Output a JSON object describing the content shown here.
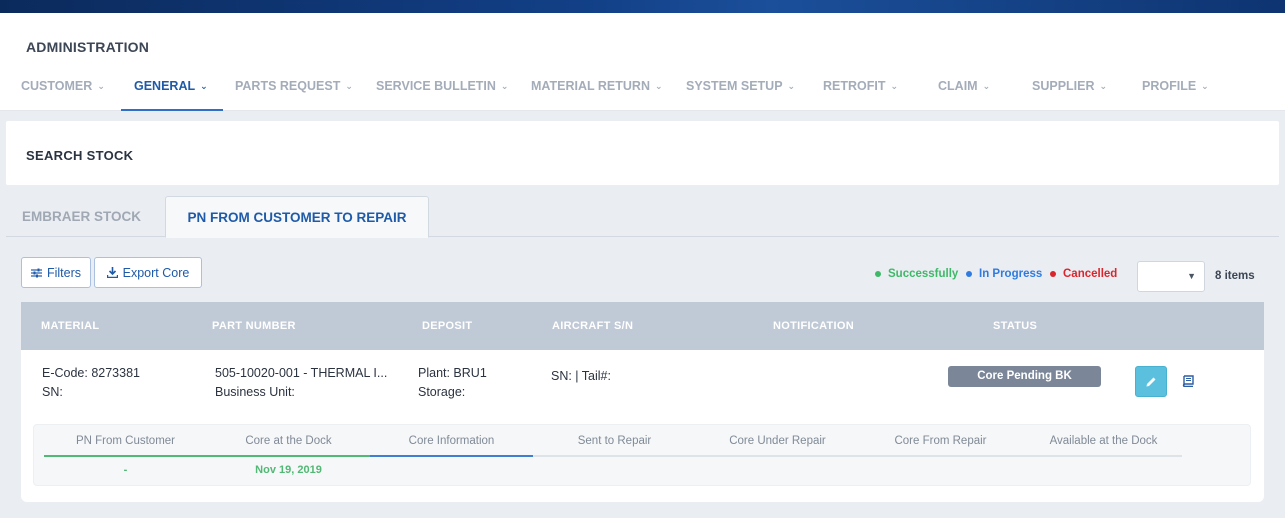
{
  "header": {
    "title": "ADMINISTRATION",
    "nav": [
      {
        "label": "CUSTOMER",
        "active": false
      },
      {
        "label": "GENERAL",
        "active": true
      },
      {
        "label": "PARTS REQUEST",
        "active": false
      },
      {
        "label": "SERVICE BULLETIN",
        "active": false
      },
      {
        "label": "MATERIAL RETURN",
        "active": false
      },
      {
        "label": "SYSTEM SETUP",
        "active": false
      },
      {
        "label": "RETROFIT",
        "active": false
      },
      {
        "label": "CLAIM",
        "active": false
      },
      {
        "label": "SUPPLIER",
        "active": false
      },
      {
        "label": "PROFILE",
        "active": false
      }
    ]
  },
  "search": {
    "title": "SEARCH STOCK"
  },
  "tabs": [
    {
      "label": "EMBRAER STOCK",
      "active": false
    },
    {
      "label": "PN FROM CUSTOMER TO REPAIR",
      "active": true
    }
  ],
  "toolbar": {
    "filters_label": "Filters",
    "export_label": "Export Core",
    "legend": [
      {
        "label": "Successfully",
        "color": "#3fb868"
      },
      {
        "label": "In Progress",
        "color": "#2f7be0"
      },
      {
        "label": "Cancelled",
        "color": "#d9262c"
      }
    ],
    "page_size_value": "",
    "items_count": "8 items"
  },
  "table": {
    "columns": [
      "MATERIAL",
      "PART NUMBER",
      "DEPOSIT",
      "AIRCRAFT S/N",
      "NOTIFICATION",
      "STATUS"
    ],
    "rows": [
      {
        "material_line1": "E-Code: 8273381",
        "material_line2": "SN:",
        "part_line1": "505-10020-001 - THERMAL I...",
        "part_line2": "Business Unit:",
        "deposit_line1": "Plant: BRU1",
        "deposit_line2": "Storage:",
        "aircraft": "SN: | Tail#:",
        "notification": "",
        "status": "Core Pending BK",
        "steps": [
          {
            "label": "PN From Customer",
            "value": "-",
            "state": "done"
          },
          {
            "label": "Core at the Dock",
            "value": "Nov 19, 2019",
            "state": "done"
          },
          {
            "label": "Core Information",
            "value": "",
            "state": "current"
          },
          {
            "label": "Sent to Repair",
            "value": "",
            "state": "pending"
          },
          {
            "label": "Core Under Repair",
            "value": "",
            "state": "pending"
          },
          {
            "label": "Core From Repair",
            "value": "",
            "state": "pending"
          },
          {
            "label": "Available at the Dock",
            "value": "",
            "state": "pending"
          }
        ]
      }
    ]
  },
  "icons": {
    "filters": "sliders-icon",
    "export": "download-icon",
    "edit": "pencil-icon",
    "details": "book-icon",
    "dropdown": "caret-down-icon",
    "chevron": "chevron-down-icon"
  }
}
